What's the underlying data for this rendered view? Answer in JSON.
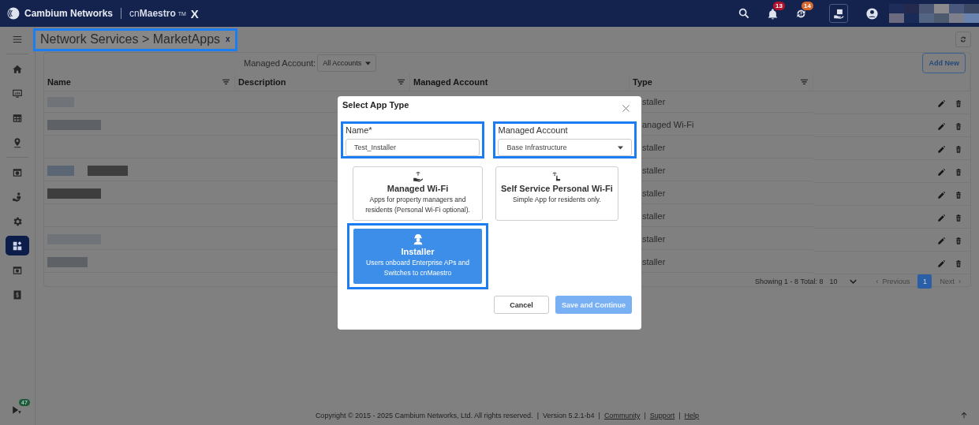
{
  "header": {
    "brand": "Cambium Networks",
    "product_light": "cn",
    "product_bold": "Maestro",
    "trademark": "TM",
    "product_suffix": "X",
    "badges": [
      {
        "count": "13",
        "color": "#b3122f"
      },
      {
        "count": "14",
        "color": "#d8692e"
      }
    ]
  },
  "sidebar": {
    "items": [
      {
        "selected": false
      },
      {
        "selected": false
      },
      {
        "selected": false
      },
      {
        "selected": false
      },
      {
        "selected": false
      },
      {
        "selected": false
      },
      {
        "selected": false
      },
      {
        "selected": true
      },
      {
        "selected": false
      },
      {
        "selected": false
      }
    ],
    "badge": "47"
  },
  "breadcrumb": {
    "text": "Network Services > MarketApps",
    "close": "x"
  },
  "toolbar": {
    "account_label": "Managed Account:",
    "account_value": "All Accounts",
    "add_button": "Add New"
  },
  "table": {
    "columns": [
      "Name",
      "Description",
      "Managed Account",
      "Type"
    ],
    "rows": [
      {
        "type": "staller"
      },
      {
        "type": "anaged Wi-Fi"
      },
      {
        "type": "staller"
      },
      {
        "type": "staller"
      },
      {
        "type": "staller"
      },
      {
        "type": "staller"
      },
      {
        "type": "staller"
      },
      {
        "type": "staller"
      }
    ]
  },
  "pagination": {
    "summary": "Showing 1 - 8 Total: 8",
    "page_size": "10",
    "previous": {
      "arrow": "‹",
      "label": "Previous",
      "disabled": true
    },
    "pages": [
      {
        "label": "1",
        "selected": true
      }
    ],
    "next": {
      "label": "Next",
      "arrow": "›",
      "disabled": true
    }
  },
  "dialog": {
    "title": "Select App Type",
    "name_label": "Name*",
    "name_value": "Test_Installer",
    "account_label": "Managed Account",
    "account_value": "Base Infrastructure",
    "cards": [
      {
        "title": "Managed Wi-Fi",
        "description": "Apps for property managers and residents (Personal Wi-Fi optional).",
        "selected": false
      },
      {
        "title": "Self Service Personal Wi-Fi",
        "description": "Simple App for residents only.",
        "selected": false
      },
      {
        "title": "Installer",
        "description": "Users onboard Enterprise APs and Switches to cnMaestro",
        "selected": true
      }
    ],
    "cancel": "Cancel",
    "save": {
      "label": "Save and Continue",
      "disabled": true
    }
  },
  "footer": [
    {
      "kind": "text",
      "text": "Copyright © 2015 - 2025 Cambium Networks, Ltd. All rights reserved."
    },
    {
      "kind": "sep",
      "text": "|"
    },
    {
      "kind": "text",
      "text": "Version 5.2.1-b4"
    },
    {
      "kind": "sep",
      "text": "|"
    },
    {
      "kind": "link",
      "text": "Community"
    },
    {
      "kind": "sep",
      "text": "|"
    },
    {
      "kind": "link",
      "text": "Support"
    },
    {
      "kind": "sep",
      "text": "|"
    },
    {
      "kind": "link",
      "text": "Help"
    }
  ]
}
